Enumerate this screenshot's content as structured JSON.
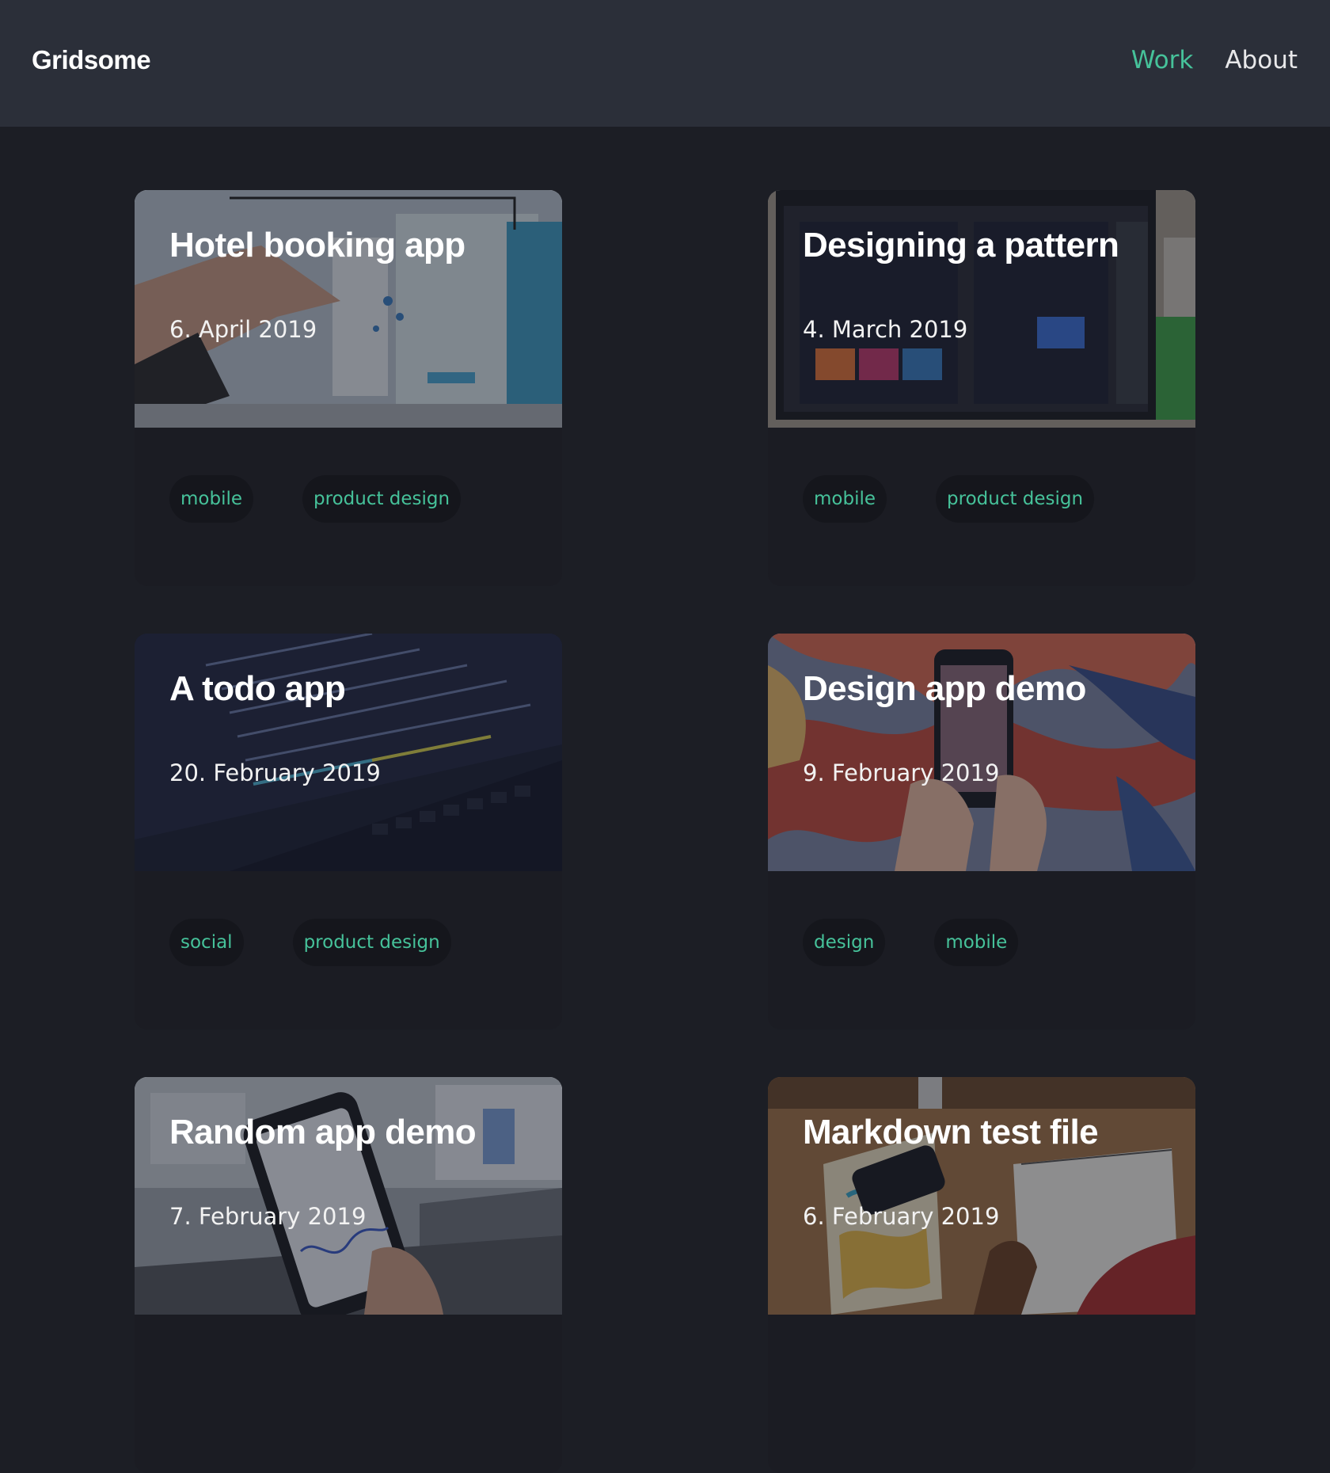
{
  "header": {
    "logo": "Gridsome",
    "nav": [
      {
        "label": "Work",
        "active": true
      },
      {
        "label": "About",
        "active": false
      }
    ]
  },
  "colors": {
    "accent": "#46c29a",
    "background": "#1c1e25",
    "header_background": "#2b2f39",
    "card_background": "#1b1c23"
  },
  "projects": [
    {
      "title": "Hotel booking app",
      "date": "6. April 2019",
      "tags": [
        "mobile",
        "product design"
      ]
    },
    {
      "title": "Designing a pattern",
      "date": "4. March 2019",
      "tags": [
        "mobile",
        "product design"
      ]
    },
    {
      "title": "A todo app",
      "date": "20. February 2019",
      "tags": [
        "social",
        "product design"
      ]
    },
    {
      "title": "Design app demo",
      "date": "9. February 2019",
      "tags": [
        "design",
        "mobile"
      ]
    },
    {
      "title": "Random app demo",
      "date": "7. February 2019",
      "tags": []
    },
    {
      "title": "Markdown test file",
      "date": "6. February 2019",
      "tags": []
    }
  ]
}
